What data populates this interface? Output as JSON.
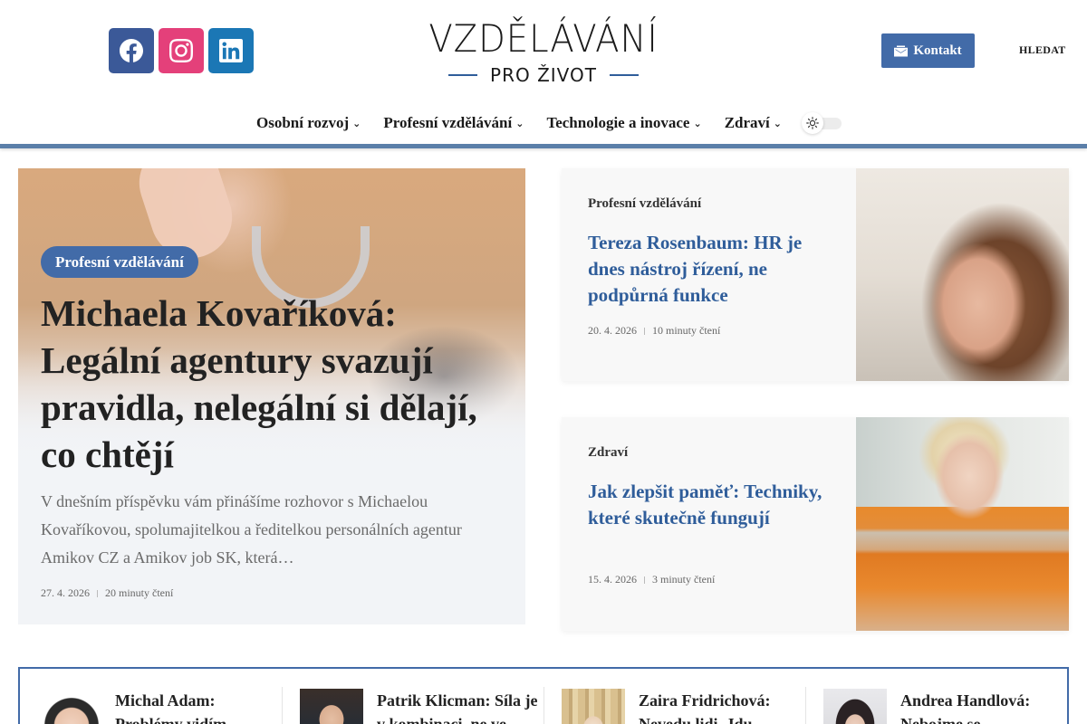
{
  "site": {
    "logo_main": "VZDĚLÁVÁNÍ",
    "logo_sub": "PRO ŽIVOT",
    "contact_label": "Kontakt",
    "search_label": "HLEDAT",
    "social": [
      "facebook-icon",
      "instagram-icon",
      "linkedin-icon"
    ],
    "accent": "#426ba8",
    "nav": [
      {
        "label": "Osobní rozvoj"
      },
      {
        "label": "Profesní vzdělávání"
      },
      {
        "label": "Technologie a inovace"
      },
      {
        "label": "Zdraví"
      }
    ]
  },
  "hero": {
    "category": "Profesní vzdělávání",
    "title": "Michaela Kovaříková: Legální agentury svazují pravidla, nelegální si dělají, co chtějí",
    "excerpt": "V dnešním příspěvku vám přinášíme rozhovor s Michaelou Kovaříkovou, spolumajitelkou a ředitelkou personálních agentur Amikov CZ a Amikov job SK, která…",
    "date": "27. 4. 2026",
    "read_time": "20 minuty čtení"
  },
  "side_articles": [
    {
      "category": "Profesní vzdělávání",
      "title": "Tereza Rosenbaum: HR je dnes nástroj řízení, ne podpůrná funkce",
      "date": "20. 4. 2026",
      "read_time": "10 minuty čtení"
    },
    {
      "category": "Zdraví",
      "title": "Jak zlepšit paměť: Techniky, které skutečně fungují",
      "date": "15. 4. 2026",
      "read_time": "3 minuty čtení"
    }
  ],
  "ticker": [
    {
      "title": "Michal Adam: Problémy vidím"
    },
    {
      "title": "Patrik Klicman: Síla je v kombinaci, ne ve"
    },
    {
      "title": "Zaira Fridrichová: Nevedu lidi. Jdu"
    },
    {
      "title": "Andrea Handlová: Nebojme se"
    }
  ]
}
